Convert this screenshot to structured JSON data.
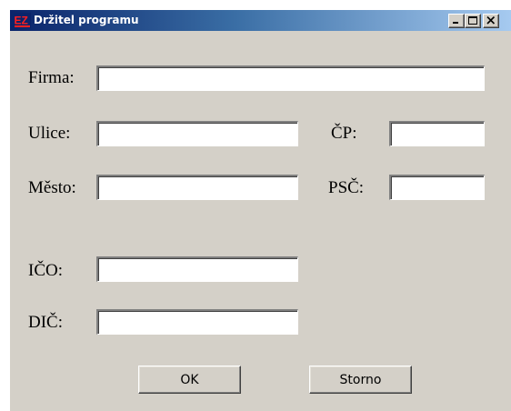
{
  "window": {
    "title": "Držitel programu",
    "icon": "app-logo-icon"
  },
  "title_buttons": [
    "minimize-icon",
    "maximize-icon",
    "close-icon"
  ],
  "form": {
    "firma": {
      "label": "Firma:",
      "value": ""
    },
    "ulice": {
      "label": "Ulice:",
      "value": ""
    },
    "cp": {
      "label": "ČP:",
      "value": ""
    },
    "mesto": {
      "label": "Město:",
      "value": ""
    },
    "psc": {
      "label": "PSČ:",
      "value": ""
    },
    "ico": {
      "label": "IČO:",
      "value": ""
    },
    "dic": {
      "label": "DIČ:",
      "value": ""
    }
  },
  "buttons": {
    "ok": "OK",
    "cancel": "Storno"
  },
  "colors": {
    "titlebar_start": "#0a246a",
    "titlebar_end": "#a6caf0",
    "dialog_face": "#d4d0c8"
  }
}
